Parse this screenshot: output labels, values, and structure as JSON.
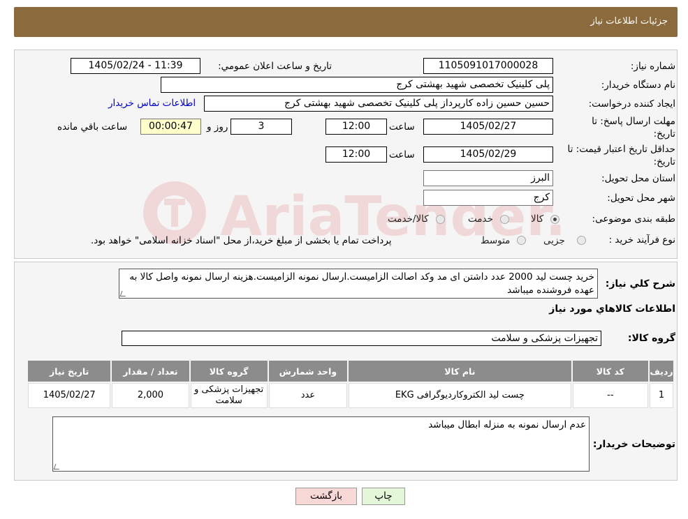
{
  "header": {
    "title": "جزئیات اطلاعات نیاز"
  },
  "labels": {
    "need_number": "شماره نیاز:",
    "announce_datetime": "تاريخ و ساعت اعلان عمومي:",
    "buyer_org": "نام دستگاه خريدار:",
    "creator": "ایجاد کننده درخواست:",
    "contact_link": "اطلاعات تماس خریدار",
    "reply_deadline": "مهلت ارسال پاسخ: تا تاریخ:",
    "time_word": "ساعت",
    "day_and": "روز و",
    "remaining": "ساعت باقي مانده",
    "price_validity": "حداقل تاريخ اعتبار قيمت: تا تاريخ:",
    "province": "استان محل تحويل:",
    "city": "شهر محل تحويل:",
    "category": "طبقه بندی موضوعی:",
    "purchase_type": "نوع فرآيند خريد :",
    "description": "شرح كلي نياز:",
    "goods_info": "اطلاعات كالاهاي مورد نياز",
    "goods_group": "گروه کالا:",
    "buyer_notes": "توضیحات خریدار:"
  },
  "values": {
    "need_number": "1105091017000028",
    "announce_datetime": "1405/02/24 - 11:39",
    "buyer_org": "پلی کلینیک تخصصی شهید بهشتی کرج",
    "creator": "حسین حسین زاده کارپرداز پلی کلینیک تخصصی شهید بهشتی کرج",
    "reply_date": "1405/02/27",
    "reply_time": "12:00",
    "days": "3",
    "remaining_time": "00:00:47",
    "validity_date": "1405/02/29",
    "validity_time": "12:00",
    "province": "البرز",
    "city": "کرج",
    "description": "خرید چست لید 2000 عدد داشتن ای مد وکد اصالت الزامیست.ارسال نمونه الزامیست.هزینه ارسال نمونه واصل کالا به عهده فروشنده میباشد",
    "goods_group": "تجهیزات پزشکی و سلامت",
    "buyer_notes": "عدم ارسال نمونه به منزله ابطال میباشد"
  },
  "category_options": [
    {
      "label": "کالا",
      "selected": true
    },
    {
      "label": "خدمت",
      "selected": false
    },
    {
      "label": "کالا/خدمت",
      "selected": false
    }
  ],
  "purchase_options": [
    {
      "label": "جزیی",
      "selected": false
    },
    {
      "label": "متوسط",
      "selected": false
    }
  ],
  "purchase_note": "پرداخت تمام یا بخشی از مبلغ خرید،از محل \"اسناد خزانه اسلامی\" خواهد بود.",
  "table": {
    "headers": [
      "ردیف",
      "کد کالا",
      "نام کالا",
      "واحد شمارش",
      "گروه کالا",
      "تعداد / مقدار",
      "تاریخ نیاز"
    ],
    "rows": [
      [
        "1",
        "--",
        "چست لید الکتروکاردیوگرافی EKG",
        "عدد",
        "تجهیزات پزشکی و سلامت",
        "2,000",
        "1405/02/27"
      ]
    ]
  },
  "buttons": {
    "print": "چاپ",
    "back": "بازگشت"
  },
  "watermark": {
    "text": "AriaTender.neT"
  },
  "colors": {
    "header_bg": "#8b6a3e",
    "table_header_bg": "#8c8c8c",
    "timer_bg": "#ffffcc",
    "print_bg": "#e4f7d9",
    "back_bg": "#f9d8d8",
    "link": "#0000cc"
  }
}
